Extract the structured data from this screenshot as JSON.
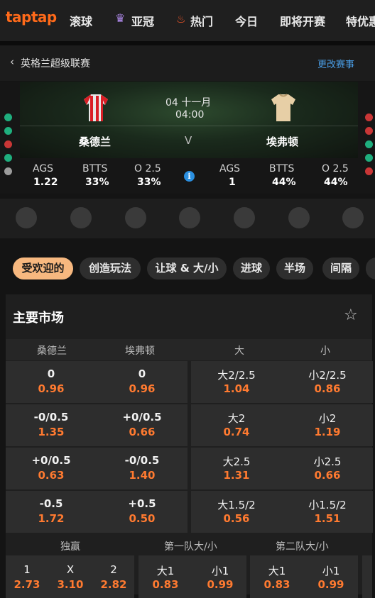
{
  "nav": {
    "logo": "taptap",
    "items": [
      "滚球",
      "亚冠",
      "热门",
      "今日",
      "即将开赛",
      "特优惠"
    ]
  },
  "header": {
    "back_label": "英格兰超级联赛",
    "change_label": "更改赛事"
  },
  "match": {
    "date": "04 十一月",
    "time": "04:00",
    "vs": "V",
    "home": {
      "name": "桑德兰",
      "ags_label": "AGS",
      "ags": "1.22",
      "btts_label": "BTTS",
      "btts": "33%",
      "o_label": "O 2.5",
      "o": "33%",
      "form": [
        "#1fae7e",
        "#1fae7e",
        "#c93636",
        "#1fae7e",
        "#9c9c9c"
      ]
    },
    "away": {
      "name": "埃弗顿",
      "ags_label": "AGS",
      "ags": "1",
      "btts_label": "BTTS",
      "btts": "44%",
      "o_label": "O 2.5",
      "o": "44%",
      "form": [
        "#c93636",
        "#c93636",
        "#1fae7e",
        "#1fae7e",
        "#c93636"
      ]
    }
  },
  "chips": [
    "受欢迎的",
    "创造玩法",
    "让球 & 大/小",
    "进球",
    "半场",
    "间隔"
  ],
  "market": {
    "title": "主要市场",
    "headers": [
      "桑德兰",
      "埃弗顿",
      "大",
      "小"
    ],
    "rows": [
      [
        "0",
        "0.96",
        "0",
        "0.96",
        "大2/2.5",
        "1.04",
        "小2/2.5",
        "0.86"
      ],
      [
        "-0/0.5",
        "1.35",
        "+0/0.5",
        "0.66",
        "大2",
        "0.74",
        "小2",
        "1.19"
      ],
      [
        "+0/0.5",
        "0.63",
        "-0/0.5",
        "1.40",
        "大2.5",
        "1.31",
        "小2.5",
        "0.66"
      ],
      [
        "-0.5",
        "1.72",
        "+0.5",
        "0.50",
        "大1.5/2",
        "0.56",
        "小1.5/2",
        "1.51"
      ]
    ],
    "sections": [
      "独赢",
      "第一队大/小",
      "第二队大/小"
    ],
    "bottom": {
      "win": [
        [
          "1",
          "2.73"
        ],
        [
          "X",
          "3.10"
        ],
        [
          "2",
          "2.82"
        ]
      ],
      "team1": [
        [
          "大1",
          "0.83"
        ],
        [
          "小1",
          "0.99"
        ]
      ],
      "team2": [
        [
          "大1",
          "0.83"
        ],
        [
          "小1",
          "0.99"
        ]
      ]
    }
  }
}
